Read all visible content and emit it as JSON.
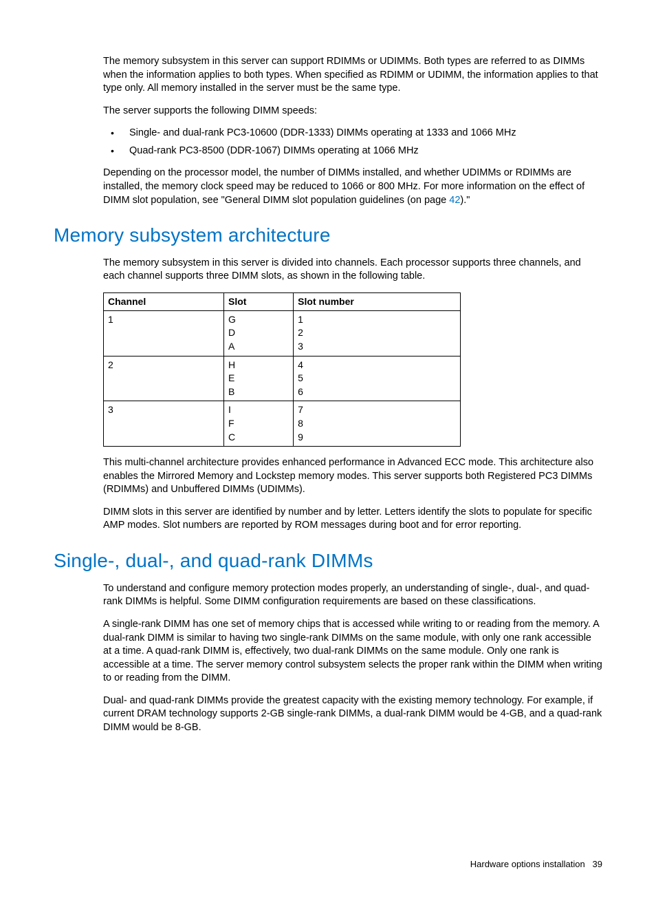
{
  "intro": {
    "p1": "The memory subsystem in this server can support RDIMMs or UDIMMs. Both types are referred to as DIMMs when the information applies to both types. When specified as RDIMM or UDIMM, the information applies to that type only. All memory installed in the server must be the same type.",
    "p2": "The server supports the following DIMM speeds:",
    "bullets": [
      "Single- and dual-rank PC3-10600 (DDR-1333) DIMMs operating at 1333 and 1066 MHz",
      "Quad-rank PC3-8500 (DDR-1067) DIMMs operating at 1066 MHz"
    ],
    "p3_a": "Depending on the processor model, the number of DIMMs installed, and whether UDIMMs or RDIMMs are installed, the memory clock speed may be reduced to 1066 or 800 MHz. For more information on the effect of DIMM slot population, see \"General DIMM slot population guidelines (on page ",
    "p3_link": "42",
    "p3_b": ").\""
  },
  "sec1": {
    "heading": "Memory subsystem architecture",
    "p1": "The memory subsystem in this server is divided into channels. Each processor supports three channels, and each channel supports three DIMM slots, as shown in the following table.",
    "table": {
      "headers": [
        "Channel",
        "Slot",
        "Slot number"
      ],
      "rows": [
        {
          "channel": "1",
          "slots": [
            "G",
            "D",
            "A"
          ],
          "nums": [
            "1",
            "2",
            "3"
          ]
        },
        {
          "channel": "2",
          "slots": [
            "H",
            "E",
            "B"
          ],
          "nums": [
            "4",
            "5",
            "6"
          ]
        },
        {
          "channel": "3",
          "slots": [
            "I",
            "F",
            "C"
          ],
          "nums": [
            "7",
            "8",
            "9"
          ]
        }
      ]
    },
    "p2": "This multi-channel architecture provides enhanced performance in Advanced ECC mode. This architecture also enables the Mirrored Memory and Lockstep memory modes. This server supports both Registered PC3 DIMMs (RDIMMs) and Unbuffered DIMMs (UDIMMs).",
    "p3": "DIMM slots in this server are identified by number and by letter. Letters identify the slots to populate for specific AMP modes. Slot numbers are reported by ROM messages during boot and for error reporting."
  },
  "sec2": {
    "heading": "Single-, dual-, and quad-rank DIMMs",
    "p1": "To understand and configure memory protection modes properly, an understanding of single-, dual-, and quad-rank DIMMs is helpful. Some DIMM configuration requirements are based on these classifications.",
    "p2": "A single-rank DIMM has one set of memory chips that is accessed while writing to or reading from the memory. A dual-rank DIMM is similar to having two single-rank DIMMs on the same module, with only one rank accessible at a time. A quad-rank DIMM is, effectively, two dual-rank DIMMs on the same module. Only one rank is accessible at a time. The server memory control subsystem selects the proper rank within the DIMM when writing to or reading from the DIMM.",
    "p3": "Dual- and quad-rank DIMMs provide the greatest capacity with the existing memory technology. For example, if current DRAM technology supports 2-GB single-rank DIMMs, a dual-rank DIMM would be 4-GB, and a quad-rank DIMM would be 8-GB."
  },
  "footer": {
    "section": "Hardware options installation",
    "page": "39"
  }
}
